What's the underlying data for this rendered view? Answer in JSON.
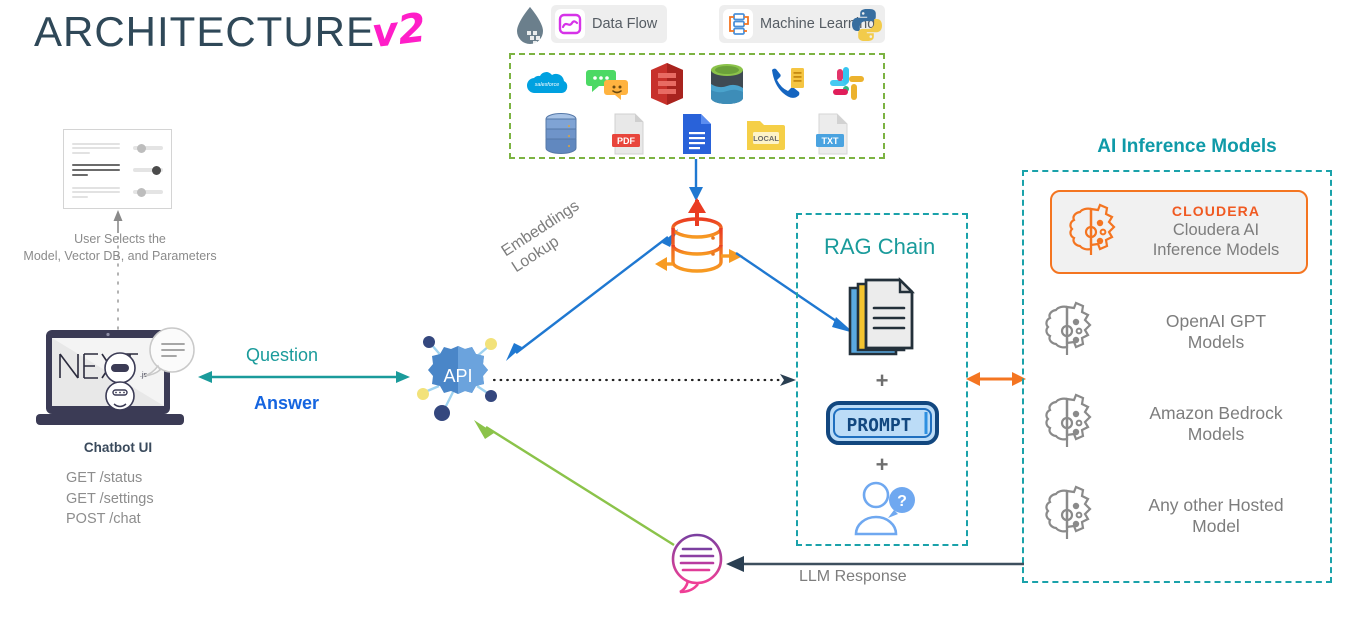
{
  "title": {
    "main": "ARCHITECTURE",
    "version": "v2"
  },
  "top_chips": [
    {
      "icon": "nifi-drop-icon",
      "label": "Data Flow",
      "badge_icon": "dataflow-graph-icon"
    },
    {
      "icon": "ml-flow-icon",
      "label": "Machine Learning",
      "badge_icon": "machine-learning-icon"
    },
    {
      "icon": "python-logo-icon",
      "label": "",
      "badge_icon": "python-logo-icon"
    }
  ],
  "data_sources": {
    "border_color": "#7cb342",
    "row1": [
      "salesforce-icon",
      "chat-bubbles-icon",
      "aws-service-icon",
      "database-cylinder-icon",
      "phone-contact-icon",
      "slack-icon"
    ],
    "row2": [
      "database-stack-icon",
      "pdf-file-icon",
      "google-docs-icon",
      "local-folder-icon",
      "txt-file-icon"
    ],
    "labels": {
      "pdf": "PDF",
      "local": "LOCAL",
      "txt": "TXT"
    }
  },
  "settings": {
    "caption_line1": "User Selects the",
    "caption_line2": "Model, Vector DB,  and Parameters"
  },
  "chatbot": {
    "label": "Chatbot UI",
    "logo_text": "NEXT",
    "logo_suffix": ".js",
    "endpoints": [
      "GET /status",
      "GET /settings",
      "POST /chat"
    ]
  },
  "flows": {
    "question": "Question",
    "answer": "Answer",
    "embeddings_lookup_line1": "Embeddings",
    "embeddings_lookup_line2": "Lookup",
    "llm_response": "LLM Response"
  },
  "rag_chain": {
    "title": "RAG Chain",
    "items": [
      "documents-icon",
      "prompt-icon",
      "user-question-icon"
    ],
    "prompt_text": "PROMPT",
    "plus": "+"
  },
  "ai_models": {
    "heading": "AI Inference Models",
    "featured": {
      "logo": "CLOUDERA",
      "name_line1": "Cloudera AI",
      "name_line2": "Inference Models",
      "icon": "brain-gear-icon",
      "accent": "#f47521"
    },
    "list": [
      {
        "icon": "brain-gear-icon",
        "line1": "OpenAI GPT",
        "line2": "Models"
      },
      {
        "icon": "brain-gear-icon",
        "line1": "Amazon Bedrock",
        "line2": "Models"
      },
      {
        "icon": "brain-gear-icon",
        "line1": "Any other Hosted",
        "line2": "Model"
      }
    ]
  },
  "colors": {
    "title": "#2f4858",
    "version": "#ff1ec8",
    "teal": "#1aa2aa",
    "blue": "#1565e0",
    "orange": "#f47521",
    "green": "#8bc34a",
    "gray_text": "#7d7d7d"
  }
}
